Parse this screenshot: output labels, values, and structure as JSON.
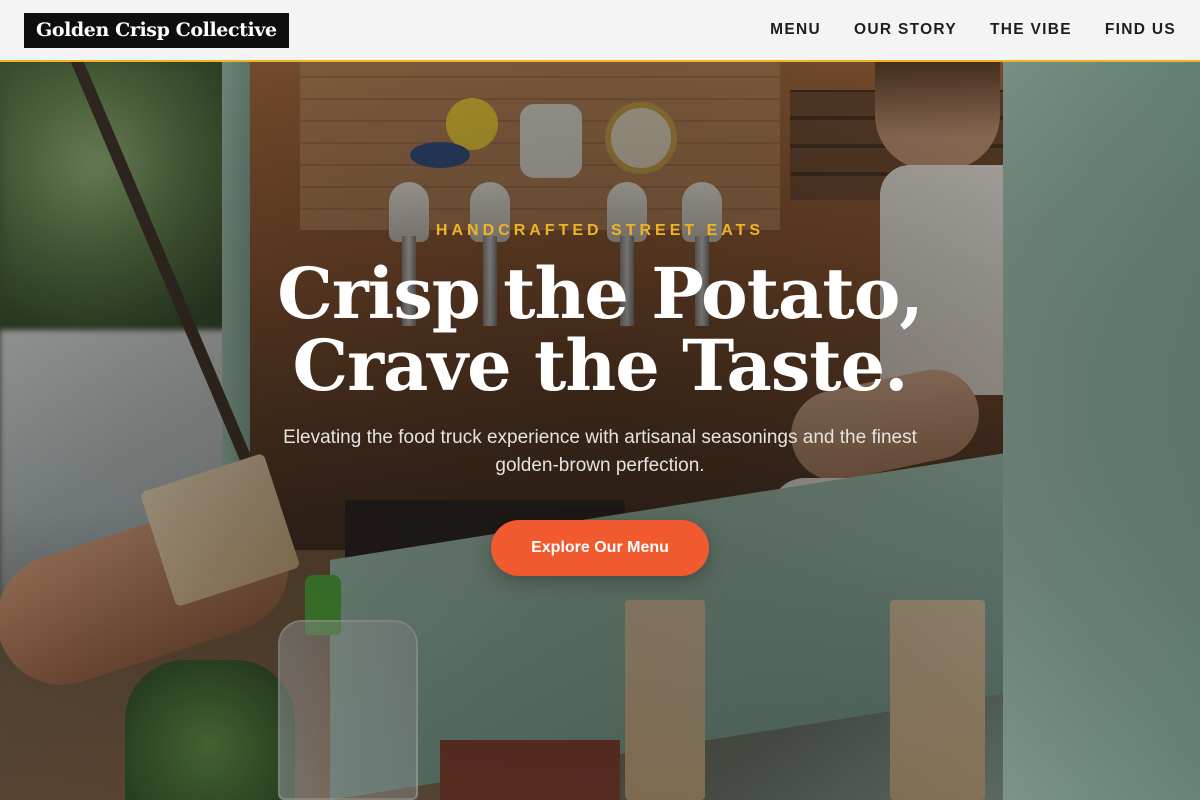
{
  "nav": {
    "brand": "Golden Crisp Collective",
    "links": [
      {
        "label": "MENU"
      },
      {
        "label": "OUR STORY"
      },
      {
        "label": "THE VIBE"
      },
      {
        "label": "FIND US"
      }
    ]
  },
  "hero": {
    "eyebrow": "HANDCRAFTED STREET EATS",
    "headline_line1": "Crisp the Potato,",
    "headline_line2": "Crave the Taste.",
    "subheading": "Elevating the food truck experience with artisanal seasonings and the finest golden-brown perfection.",
    "cta_label": "Explore Our Menu"
  },
  "colors": {
    "accent_gold": "#f0b323",
    "cta_orange": "#f15a2e",
    "nav_background": "#f4f4f4",
    "brand_background": "#0e0e0e"
  }
}
